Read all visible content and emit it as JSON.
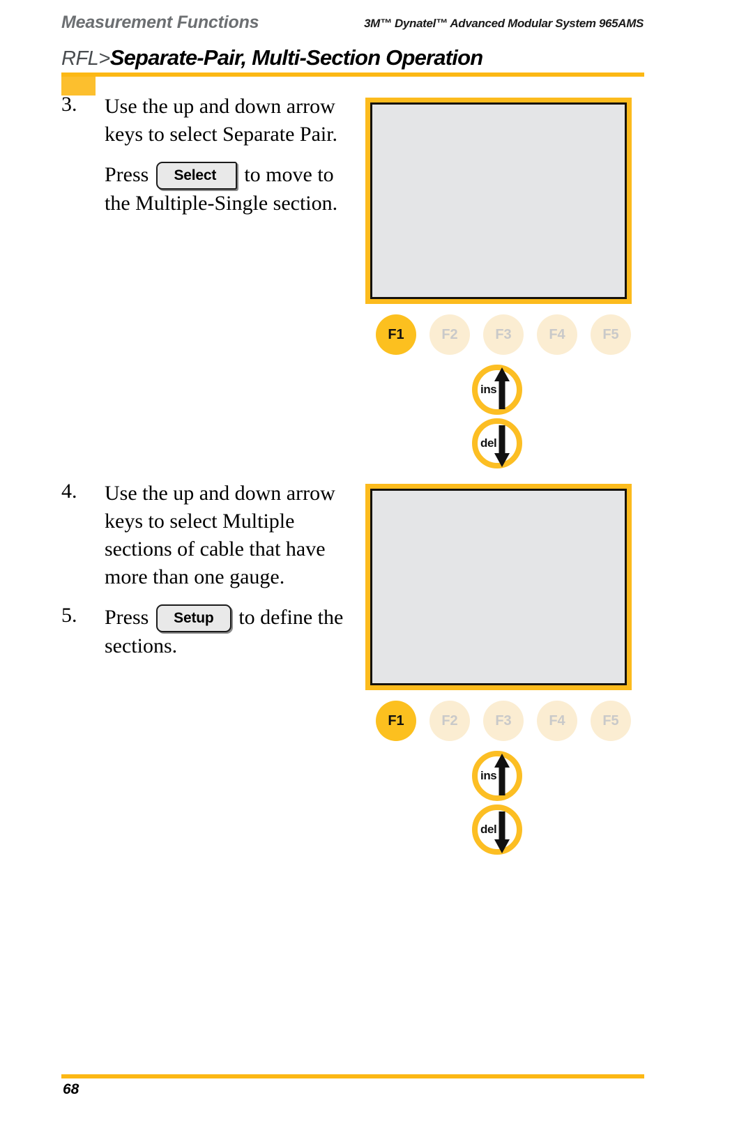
{
  "header": {
    "left_title": "Measurement Functions",
    "right_title": "3M™ Dynatel™ Advanced Modular System 965AMS"
  },
  "title": {
    "prefix": "RFL>",
    "main": "Separate-Pair, Multi-Section Operation"
  },
  "steps": [
    {
      "number": "3.",
      "lines": [
        "Use the up and down arrow",
        "keys to select Separate Pair."
      ],
      "press_prefix": "Press",
      "keycap_label": "Select",
      "press_suffix": "to move to",
      "press_line2": "the Multiple-Single section."
    },
    {
      "number": "4.",
      "lines": [
        "Use the up and down arrow",
        "keys to select Multiple",
        "sections of cable that have",
        "more than one gauge."
      ]
    },
    {
      "number": "5.",
      "press_prefix": "Press",
      "keycap_label": "Setup",
      "press_suffix": "to define the",
      "press_line2": "sections."
    }
  ],
  "device": {
    "screen_content": "",
    "function_keys": [
      {
        "label": "F1",
        "state": "active"
      },
      {
        "label": "F2",
        "state": "inactive"
      },
      {
        "label": "F3",
        "state": "inactive"
      },
      {
        "label": "F4",
        "state": "inactive"
      },
      {
        "label": "F5",
        "state": "inactive"
      }
    ],
    "arrow_keys": [
      {
        "label": "ins",
        "direction": "up"
      },
      {
        "label": "del",
        "direction": "down"
      }
    ]
  },
  "footer": {
    "page_number": "68"
  },
  "colors": {
    "brand_yellow": "#fcb814",
    "key_active": "#fcc01f",
    "key_inactive": "#fbedd2",
    "lcd_screen": "#e4e5e7",
    "header_gray": "#6c6f72"
  }
}
